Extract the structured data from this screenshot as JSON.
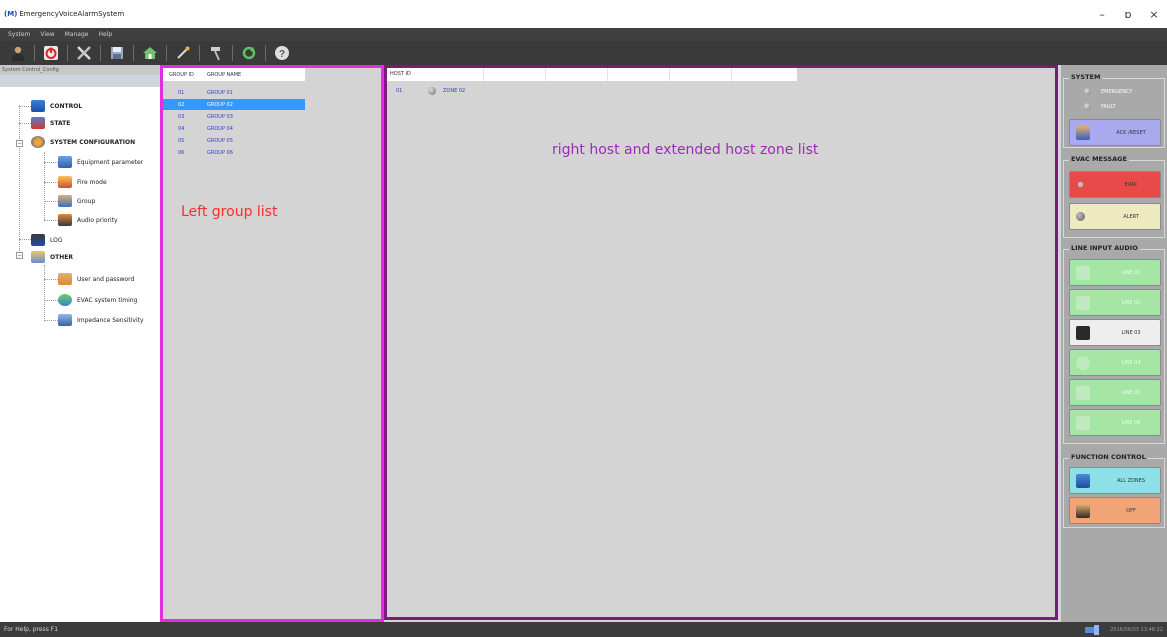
{
  "window": {
    "app_icon": "(M)",
    "title": "EmergencyVoiceAlarmSystem",
    "minimize": "–",
    "maximize": "ɒ",
    "close": "×"
  },
  "menu": [
    "System",
    "View",
    "Manage",
    "Help"
  ],
  "toolbar": {
    "icons": [
      "user-icon",
      "power-icon",
      "tools-icon",
      "save-icon",
      "home-icon",
      "magic-icon",
      "hammer-icon",
      "refresh-icon",
      "help-icon"
    ]
  },
  "tree": {
    "header": "System Control_Config",
    "items": [
      {
        "label": "CONTROL",
        "bold": true,
        "icon": "monitor-icon"
      },
      {
        "label": "STATE",
        "bold": true,
        "icon": "state-icon"
      },
      {
        "label": "SYSTEM CONFIGURATION",
        "bold": true,
        "icon": "config-gear-icon"
      },
      {
        "label": "Equipment parameter",
        "bold": false,
        "icon": "equipment-icon"
      },
      {
        "label": "Fire mode",
        "bold": false,
        "icon": "fire-icon"
      },
      {
        "label": "Group",
        "bold": false,
        "icon": "group-icon"
      },
      {
        "label": "Audio priority",
        "bold": false,
        "icon": "audio-priority-icon"
      },
      {
        "label": "LOG",
        "bold": false,
        "icon": "log-icon"
      },
      {
        "label": "OTHER",
        "bold": true,
        "icon": "other-icon"
      },
      {
        "label": "User and password",
        "bold": false,
        "icon": "user-password-icon"
      },
      {
        "label": "EVAC system timing",
        "bold": false,
        "icon": "timing-icon"
      },
      {
        "label": "Impedance Sensitivity",
        "bold": false,
        "icon": "impedance-icon"
      }
    ]
  },
  "groups": {
    "col_id": "GROUP ID",
    "col_name": "GROUP NAME",
    "selected_index": 1,
    "rows": [
      {
        "id": "01",
        "name": "GROUP 01"
      },
      {
        "id": "02",
        "name": "GROUP 02"
      },
      {
        "id": "03",
        "name": "GROUP 03"
      },
      {
        "id": "04",
        "name": "GROUP 04"
      },
      {
        "id": "05",
        "name": "GROUP 05"
      },
      {
        "id": "06",
        "name": "GROUP 06"
      }
    ],
    "annotation": "Left group list"
  },
  "hosts": {
    "col_id": "HOST ID",
    "rows": [
      {
        "id": "01",
        "zone": "ZONE 02"
      }
    ],
    "annotation": "right host and extended host zone list"
  },
  "controls": {
    "system": {
      "title": "SYSTEM",
      "lamps": [
        "EMERGENCY",
        "FAULT"
      ],
      "ack_reset": "ACK /RESET"
    },
    "evac": {
      "title": "EVAC MESSAGE",
      "evac_label": "EVAC",
      "alert_label": "ALERT"
    },
    "line_input": {
      "title": "LINE INPUT AUDIO",
      "lines": [
        {
          "label": "LINE 01",
          "active": false
        },
        {
          "label": "LINE 02",
          "active": false
        },
        {
          "label": "LINE 03",
          "active": true
        },
        {
          "label": "LINE 04",
          "active": false
        },
        {
          "label": "LINE 05",
          "active": false
        },
        {
          "label": "LINE 06",
          "active": false
        }
      ]
    },
    "function": {
      "title": "FUNCTION CONTROL",
      "all_zones": "ALL ZONES",
      "off": "OFF"
    },
    "colors": {
      "evac_bg": "#e84a4a",
      "alert_bg": "#eeeac0",
      "ack_bg": "#a9a9f0",
      "line_active_bg": "#eeeeee",
      "line_faded_bg": "#a5e6a5",
      "all_zones_bg": "#8ee0e8",
      "off_bg": "#f0a477"
    }
  },
  "status": {
    "help": "For Help, press F1",
    "datetime": "2016/06/03 13:46:22"
  }
}
